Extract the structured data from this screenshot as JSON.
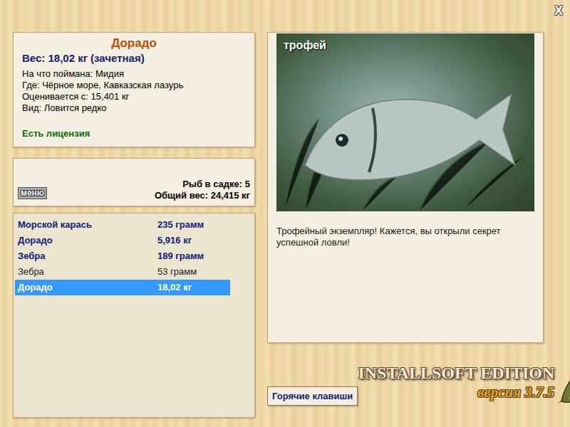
{
  "window": {
    "close": "X"
  },
  "fish": {
    "name": "Дорадо",
    "weight": "Вес: 18,02 кг (зачетная)",
    "details": [
      "На что поймана: Мидия",
      "Где: Чёрное море, Кавказская лазурь",
      "Оценивается с: 15,401 кг",
      "Вид: Ловится редко"
    ],
    "license": "Есть лицензия"
  },
  "keepnet": {
    "menu": "меню",
    "count": "Рыб в садке: 5",
    "total": "Общий вес: 24,415 кг"
  },
  "catch": [
    {
      "name": "Морской карась",
      "weight": "235 грамм",
      "counted": true,
      "selected": false
    },
    {
      "name": "Дорадо",
      "weight": "5,916 кг",
      "counted": true,
      "selected": false
    },
    {
      "name": "Зебра",
      "weight": "189 грамм",
      "counted": true,
      "selected": false
    },
    {
      "name": "Зебра",
      "weight": "53 грамм",
      "counted": false,
      "selected": false
    },
    {
      "name": "Дорадо",
      "weight": "18,02 кг",
      "counted": true,
      "selected": true
    }
  ],
  "photo": {
    "badge": "трофей"
  },
  "description": "Трофейный экземпляр! Кажется, вы открыли секрет успешной ловли!",
  "hotkeys": "Горячие клавиши",
  "logo": {
    "title": "INSTALLSOFT EDITION",
    "version": "версия 3.7.5"
  }
}
